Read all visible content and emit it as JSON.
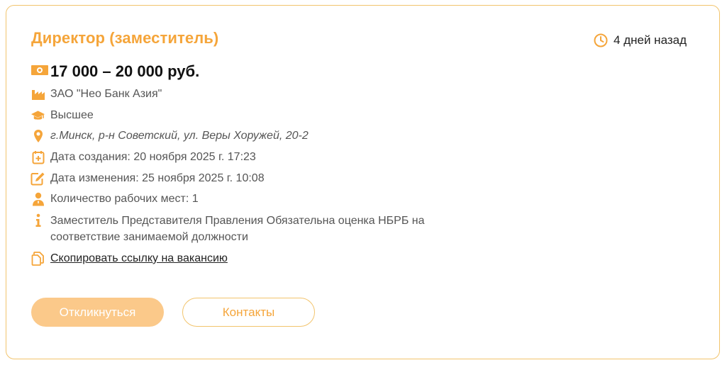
{
  "vacancy": {
    "title": "Директор (заместитель)",
    "posted": "4 дней назад",
    "salary": "17 000 – 20 000 руб.",
    "company": "ЗАО \"Нео Банк Азия\"",
    "education": "Высшее",
    "address": "г.Минск, р-н Советский, ул. Веры Хоружей, 20-2",
    "created": "Дата создания: 20 ноября 2025 г. 17:23",
    "updated": "Дата изменения: 25 ноября 2025 г. 10:08",
    "workplaces": "Количество рабочих мест: 1",
    "description": "Заместитель Представителя Правления Обязательна оценка НБРБ на соответствие занимаемой должности",
    "copy_link": "Скопировать ссылку на вакансию"
  },
  "actions": {
    "respond_label": "Откликнуться",
    "contacts_label": "Контакты"
  },
  "icons": {
    "clock": "clock-icon",
    "salary": "money-icon",
    "company": "factory-icon",
    "education": "graduation-cap-icon",
    "address": "location-pin-icon",
    "created": "calendar-plus-icon",
    "updated": "edit-icon",
    "workplaces": "person-icon",
    "description": "info-icon",
    "copy": "copy-icon"
  },
  "colors": {
    "accent": "#f5a53a",
    "border": "#f2c46d",
    "primary_button": "#fbc98a"
  }
}
